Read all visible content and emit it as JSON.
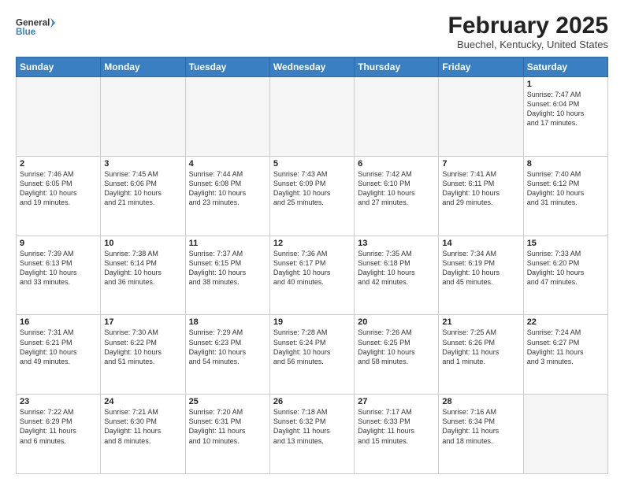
{
  "header": {
    "logo_line1": "General",
    "logo_line2": "Blue",
    "month": "February 2025",
    "location": "Buechel, Kentucky, United States"
  },
  "weekdays": [
    "Sunday",
    "Monday",
    "Tuesday",
    "Wednesday",
    "Thursday",
    "Friday",
    "Saturday"
  ],
  "weeks": [
    [
      {
        "day": "",
        "info": "",
        "empty": true
      },
      {
        "day": "",
        "info": "",
        "empty": true
      },
      {
        "day": "",
        "info": "",
        "empty": true
      },
      {
        "day": "",
        "info": "",
        "empty": true
      },
      {
        "day": "",
        "info": "",
        "empty": true
      },
      {
        "day": "",
        "info": "",
        "empty": true
      },
      {
        "day": "1",
        "info": "Sunrise: 7:47 AM\nSunset: 6:04 PM\nDaylight: 10 hours\nand 17 minutes."
      }
    ],
    [
      {
        "day": "2",
        "info": "Sunrise: 7:46 AM\nSunset: 6:05 PM\nDaylight: 10 hours\nand 19 minutes."
      },
      {
        "day": "3",
        "info": "Sunrise: 7:45 AM\nSunset: 6:06 PM\nDaylight: 10 hours\nand 21 minutes."
      },
      {
        "day": "4",
        "info": "Sunrise: 7:44 AM\nSunset: 6:08 PM\nDaylight: 10 hours\nand 23 minutes."
      },
      {
        "day": "5",
        "info": "Sunrise: 7:43 AM\nSunset: 6:09 PM\nDaylight: 10 hours\nand 25 minutes."
      },
      {
        "day": "6",
        "info": "Sunrise: 7:42 AM\nSunset: 6:10 PM\nDaylight: 10 hours\nand 27 minutes."
      },
      {
        "day": "7",
        "info": "Sunrise: 7:41 AM\nSunset: 6:11 PM\nDaylight: 10 hours\nand 29 minutes."
      },
      {
        "day": "8",
        "info": "Sunrise: 7:40 AM\nSunset: 6:12 PM\nDaylight: 10 hours\nand 31 minutes."
      }
    ],
    [
      {
        "day": "9",
        "info": "Sunrise: 7:39 AM\nSunset: 6:13 PM\nDaylight: 10 hours\nand 33 minutes."
      },
      {
        "day": "10",
        "info": "Sunrise: 7:38 AM\nSunset: 6:14 PM\nDaylight: 10 hours\nand 36 minutes."
      },
      {
        "day": "11",
        "info": "Sunrise: 7:37 AM\nSunset: 6:15 PM\nDaylight: 10 hours\nand 38 minutes."
      },
      {
        "day": "12",
        "info": "Sunrise: 7:36 AM\nSunset: 6:17 PM\nDaylight: 10 hours\nand 40 minutes."
      },
      {
        "day": "13",
        "info": "Sunrise: 7:35 AM\nSunset: 6:18 PM\nDaylight: 10 hours\nand 42 minutes."
      },
      {
        "day": "14",
        "info": "Sunrise: 7:34 AM\nSunset: 6:19 PM\nDaylight: 10 hours\nand 45 minutes."
      },
      {
        "day": "15",
        "info": "Sunrise: 7:33 AM\nSunset: 6:20 PM\nDaylight: 10 hours\nand 47 minutes."
      }
    ],
    [
      {
        "day": "16",
        "info": "Sunrise: 7:31 AM\nSunset: 6:21 PM\nDaylight: 10 hours\nand 49 minutes."
      },
      {
        "day": "17",
        "info": "Sunrise: 7:30 AM\nSunset: 6:22 PM\nDaylight: 10 hours\nand 51 minutes."
      },
      {
        "day": "18",
        "info": "Sunrise: 7:29 AM\nSunset: 6:23 PM\nDaylight: 10 hours\nand 54 minutes."
      },
      {
        "day": "19",
        "info": "Sunrise: 7:28 AM\nSunset: 6:24 PM\nDaylight: 10 hours\nand 56 minutes."
      },
      {
        "day": "20",
        "info": "Sunrise: 7:26 AM\nSunset: 6:25 PM\nDaylight: 10 hours\nand 58 minutes."
      },
      {
        "day": "21",
        "info": "Sunrise: 7:25 AM\nSunset: 6:26 PM\nDaylight: 11 hours\nand 1 minute."
      },
      {
        "day": "22",
        "info": "Sunrise: 7:24 AM\nSunset: 6:27 PM\nDaylight: 11 hours\nand 3 minutes."
      }
    ],
    [
      {
        "day": "23",
        "info": "Sunrise: 7:22 AM\nSunset: 6:29 PM\nDaylight: 11 hours\nand 6 minutes."
      },
      {
        "day": "24",
        "info": "Sunrise: 7:21 AM\nSunset: 6:30 PM\nDaylight: 11 hours\nand 8 minutes."
      },
      {
        "day": "25",
        "info": "Sunrise: 7:20 AM\nSunset: 6:31 PM\nDaylight: 11 hours\nand 10 minutes."
      },
      {
        "day": "26",
        "info": "Sunrise: 7:18 AM\nSunset: 6:32 PM\nDaylight: 11 hours\nand 13 minutes."
      },
      {
        "day": "27",
        "info": "Sunrise: 7:17 AM\nSunset: 6:33 PM\nDaylight: 11 hours\nand 15 minutes."
      },
      {
        "day": "28",
        "info": "Sunrise: 7:16 AM\nSunset: 6:34 PM\nDaylight: 11 hours\nand 18 minutes."
      },
      {
        "day": "",
        "info": "",
        "empty": true
      }
    ]
  ]
}
